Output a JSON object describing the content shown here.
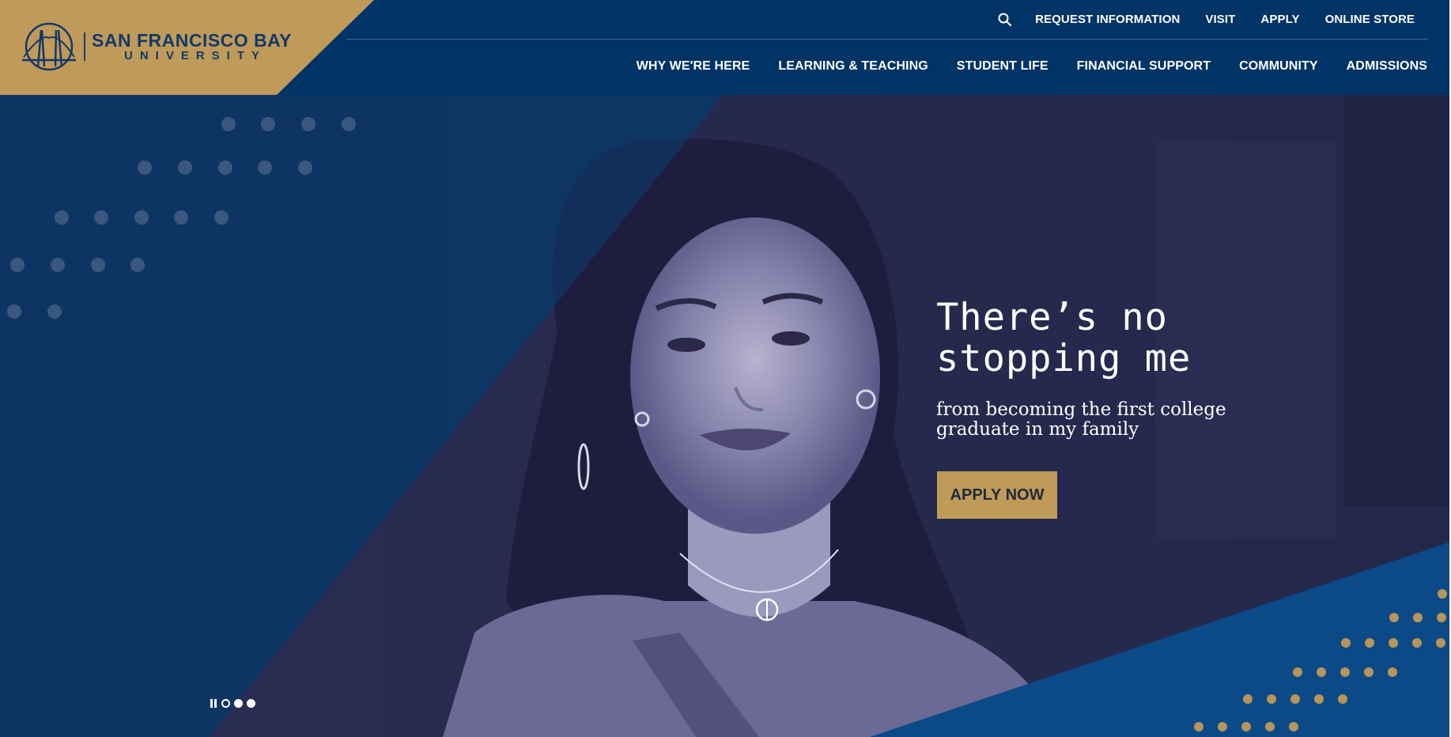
{
  "header": {
    "logo": {
      "line1": "SAN FRANCISCO BAY",
      "line2": "UNIVERSITY"
    },
    "utility_nav": [
      {
        "label": "REQUEST INFORMATION"
      },
      {
        "label": "VISIT"
      },
      {
        "label": "APPLY"
      },
      {
        "label": "ONLINE STORE"
      }
    ],
    "main_nav": [
      {
        "label": "WHY WE'RE HERE"
      },
      {
        "label": "LEARNING & TEACHING"
      },
      {
        "label": "STUDENT LIFE"
      },
      {
        "label": "FINANCIAL SUPPORT"
      },
      {
        "label": "COMMUNITY"
      },
      {
        "label": "ADMISSIONS"
      }
    ],
    "icons": {
      "search": "search-icon",
      "logo": "bridge-logo-icon"
    }
  },
  "hero": {
    "heading": "There’s no\nstopping me",
    "subheading": "from becoming the first college graduate in my family",
    "cta_label": "APPLY NOW",
    "slider": {
      "slide_count": 3,
      "active_index": 0,
      "paused": false
    }
  },
  "colors": {
    "navy": "#003366",
    "gold": "#c09a58",
    "hero_blue": "#0e3463",
    "accent_blue": "#0b4a86",
    "text_white": "#ffffff"
  }
}
